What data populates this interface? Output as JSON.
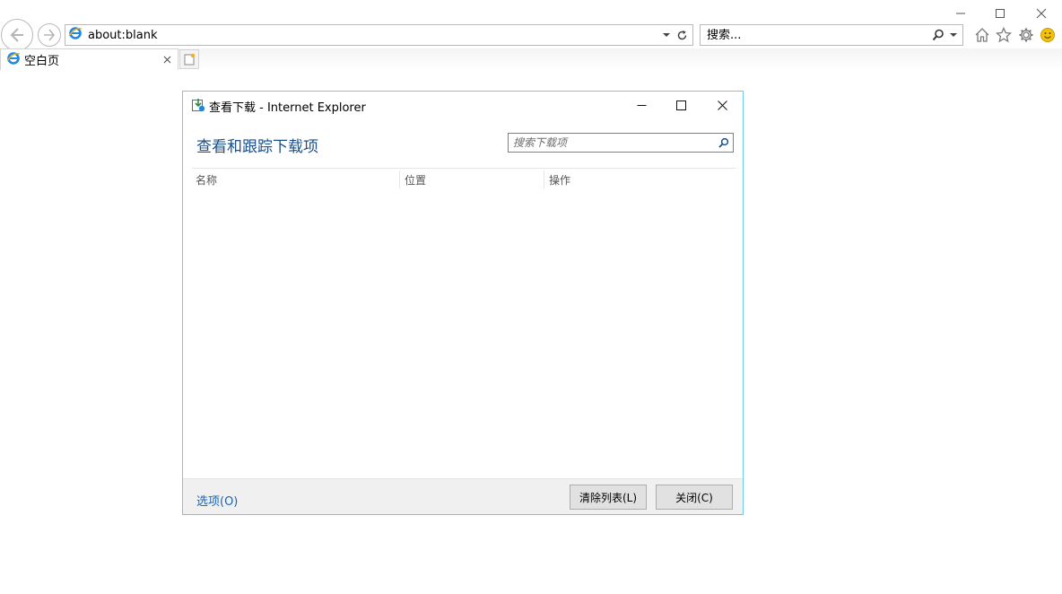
{
  "browser": {
    "address": "about:blank",
    "search_placeholder": "搜索...",
    "tab_label": "空白页"
  },
  "dialog": {
    "title": "查看下载 - Internet Explorer",
    "heading": "查看和跟踪下载项",
    "search_placeholder": "搜索下载项",
    "columns": [
      "名称",
      "位置",
      "操作"
    ],
    "options_link": "选项(O)",
    "clear_button": "清除列表(L)",
    "close_button": "关闭(C)"
  },
  "colors": {
    "heading": "#1a4f8a",
    "link": "#1a63b5",
    "dialog_border": "#6fcbe6",
    "ie_blue": "#1e88e5",
    "smiley": "#f4c20d"
  },
  "icons": {
    "back": "arrow-left-icon",
    "forward": "arrow-right-icon",
    "refresh": "refresh-icon",
    "home": "home-icon",
    "favorites": "star-icon",
    "tools": "gear-icon",
    "feedback": "smiley-icon"
  }
}
